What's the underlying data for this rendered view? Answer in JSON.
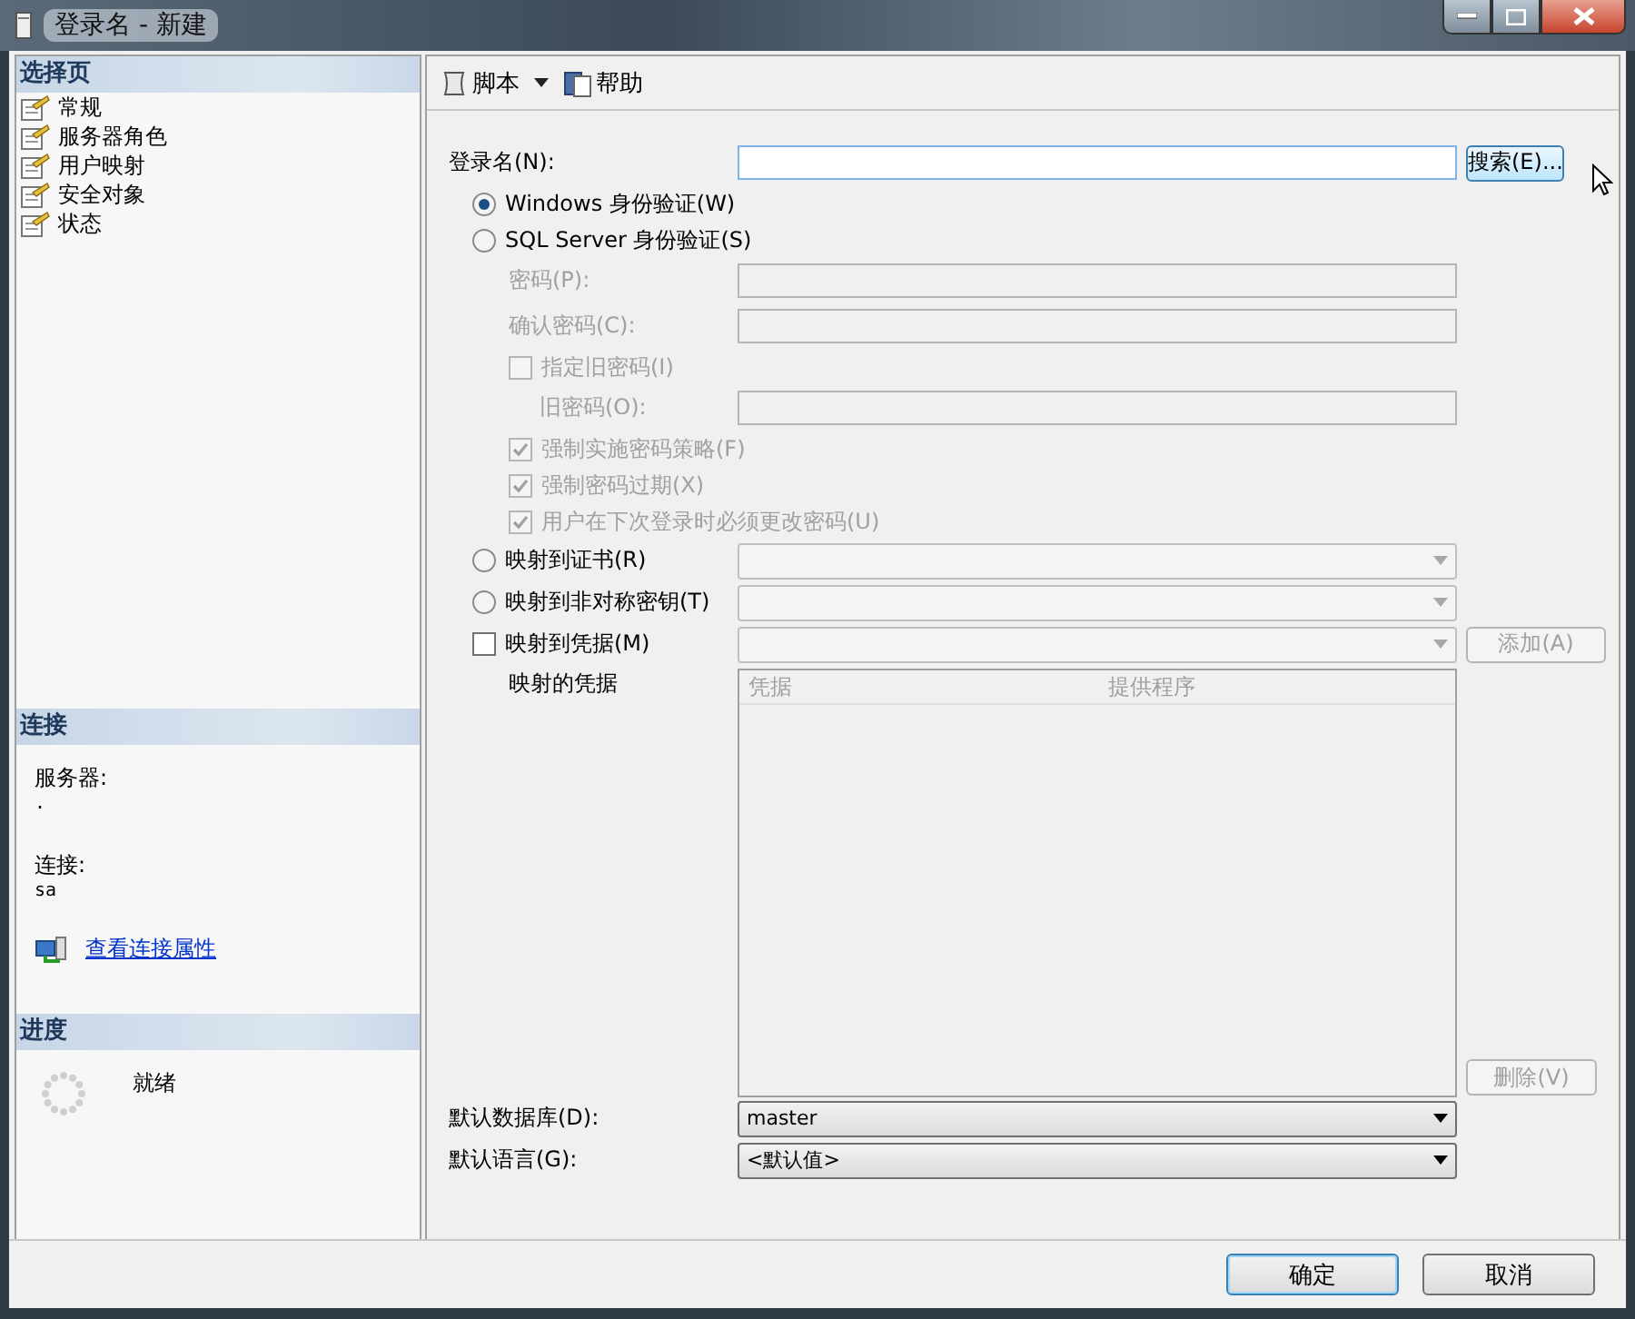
{
  "window": {
    "title": "登录名 - 新建"
  },
  "pages_panel": {
    "title": "选择页",
    "items": [
      {
        "label": "常规"
      },
      {
        "label": "服务器角色"
      },
      {
        "label": "用户映射"
      },
      {
        "label": "安全对象"
      },
      {
        "label": "状态"
      }
    ]
  },
  "connection_panel": {
    "title": "连接",
    "server_label": "服务器:",
    "server_value": ".",
    "connection_label": "连接:",
    "connection_value": "sa",
    "link": "查看连接属性"
  },
  "progress_panel": {
    "title": "进度",
    "status": "就绪"
  },
  "toolbar": [
    {
      "kind": "script",
      "label": "脚本",
      "dropdown": true
    },
    {
      "kind": "help",
      "label": "帮助",
      "dropdown": false
    }
  ],
  "form": {
    "rows": [
      {
        "kind": "field",
        "label": "登录名(N):",
        "disabled": false,
        "button": {
          "label": "搜索(E)...",
          "disabled": false
        }
      },
      {
        "kind": "radio",
        "label": "Windows 身份验证(W)",
        "selected": true
      },
      {
        "kind": "radio",
        "label": "SQL Server 身份验证(S)",
        "selected": false,
        "children": [
          {
            "kind": "field",
            "label": "密码(P):",
            "disabled": true
          },
          {
            "kind": "field",
            "label": "确认密码(C):",
            "disabled": true
          },
          {
            "kind": "checkbox",
            "label": "指定旧密码(I)",
            "checked": false,
            "disabled": true,
            "children": [
              {
                "kind": "field",
                "label": "旧密码(O):",
                "disabled": true
              }
            ]
          },
          {
            "kind": "checkbox",
            "label": "强制实施密码策略(F)",
            "checked": true,
            "disabled": true
          },
          {
            "kind": "checkbox",
            "label": "强制密码过期(X)",
            "checked": true,
            "disabled": true
          },
          {
            "kind": "checkbox",
            "label": "用户在下次登录时必须更改密码(U)",
            "checked": true,
            "disabled": true
          }
        ]
      },
      {
        "kind": "radio",
        "label": "映射到证书(R)",
        "selected": false,
        "combo": {
          "disabled": true
        }
      },
      {
        "kind": "radio",
        "label": "映射到非对称密钥(T)",
        "selected": false,
        "combo": {
          "disabled": true
        }
      },
      {
        "kind": "checkbox",
        "label": "映射到凭据(M)",
        "checked": false,
        "disabled": false,
        "combo": {
          "disabled": true
        },
        "button": {
          "label": "添加(A)",
          "disabled": true
        }
      },
      {
        "kind": "credentials",
        "label": "映射的凭据",
        "columns": [
          "凭据",
          "提供程序"
        ],
        "button": {
          "label": "删除(V)",
          "disabled": true
        }
      },
      {
        "kind": "combo",
        "label": "默认数据库(D):",
        "combo": {
          "value": "master",
          "disabled": false
        }
      },
      {
        "kind": "combo",
        "label": "默认语言(G):",
        "combo": {
          "value": "<默认值>",
          "disabled": false
        }
      }
    ]
  },
  "footer": {
    "buttons": [
      {
        "label": "确定",
        "default": true
      },
      {
        "label": "取消",
        "default": false
      }
    ]
  }
}
